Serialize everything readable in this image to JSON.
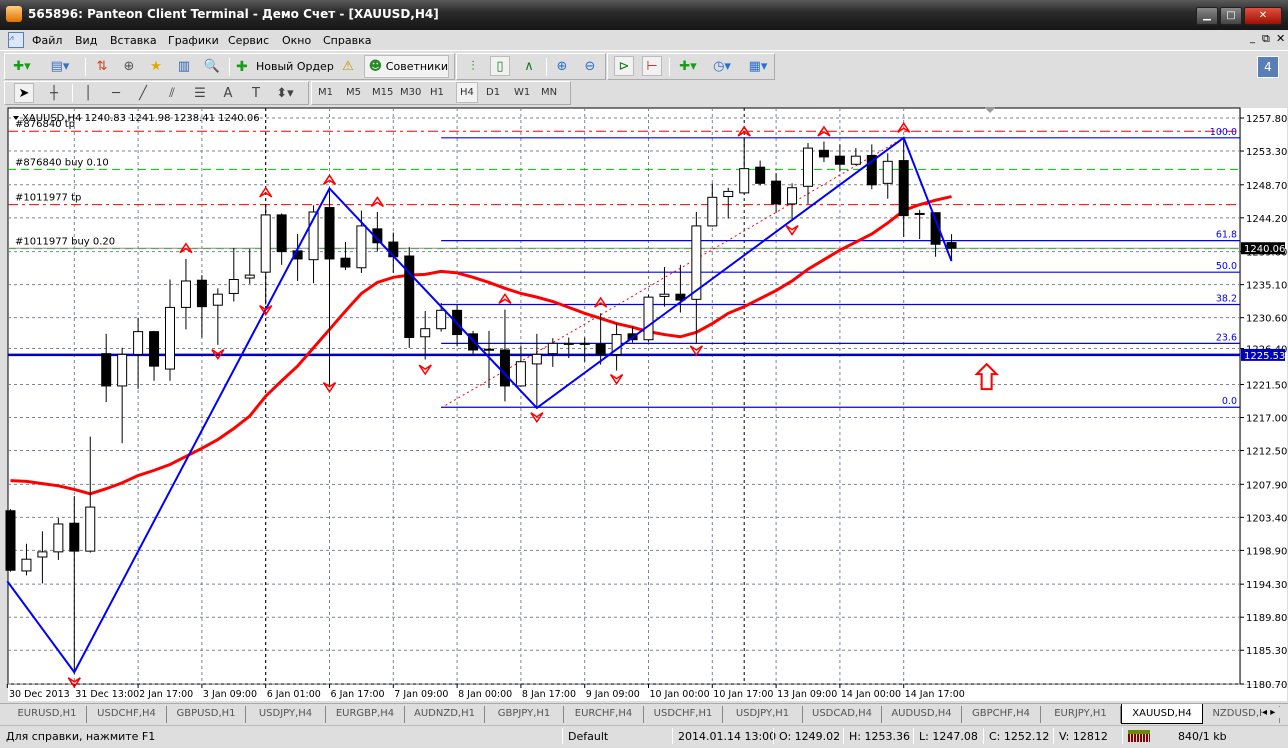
{
  "window": {
    "title": "565896: Panteon Client Terminal - Демо Счет - [XAUUSD,H4]"
  },
  "menu": [
    "Файл",
    "Вид",
    "Вставка",
    "Графики",
    "Сервис",
    "Окно",
    "Справка"
  ],
  "toolbar": {
    "new_order": "Новый Ордер",
    "experts": "Советники",
    "notification_count": "4"
  },
  "timeframes": [
    "M1",
    "M5",
    "M15",
    "M30",
    "H1",
    "H4",
    "D1",
    "W1",
    "MN"
  ],
  "active_timeframe": "H4",
  "chart_header": {
    "symbol": "XAUUSD,H4",
    "ohlc": "1240.83 1241.98 1238.41 1240.06"
  },
  "order_lines": [
    {
      "label": "#876840 tp",
      "price": 1256.0,
      "color": "#ff0000",
      "style": "dashdot"
    },
    {
      "label": "#876840 buy 0.10",
      "price": 1250.8,
      "color": "#00c000",
      "style": "dash"
    },
    {
      "label": "#1011977 tp",
      "price": 1246.0,
      "color": "#ff0000",
      "style": "dashdot"
    },
    {
      "label": "#1011977 buy 0.20",
      "price": 1240.0,
      "color": "#00c000",
      "style": "dash"
    }
  ],
  "price_badges": {
    "bid": "1240.06",
    "hline": "1225.53"
  },
  "tabs": [
    "EURUSD,H1",
    "USDCHF,H4",
    "GBPUSD,H1",
    "USDJPY,H4",
    "EURGBP,H4",
    "AUDNZD,H1",
    "GBPJPY,H1",
    "EURCHF,H4",
    "USDCHF,H1",
    "USDJPY,H1",
    "USDCAD,H4",
    "AUDUSD,H4",
    "GBPCHF,H4",
    "EURJPY,H1",
    "XAUUSD,H4",
    "NZDUSD,H"
  ],
  "active_tab": "XAUUSD,H4",
  "status": {
    "help": "Для справки, нажмите F1",
    "profile": "Default",
    "time": "2014.01.14 13:00",
    "open": "O: 1249.02",
    "high": "H: 1253.36",
    "low": "L: 1247.08",
    "close": "C: 1252.12",
    "volume": "V: 12812",
    "traffic": "840/1 kb"
  },
  "chart_data": {
    "type": "candlestick",
    "symbol": "XAUUSD",
    "timeframe": "H4",
    "ylim": [
      1180.7,
      1257.8
    ],
    "y_ticks": [
      "1257.80",
      "1253.30",
      "1248.70",
      "1244.20",
      "1239.60",
      "1235.10",
      "1230.60",
      "1226.40",
      "1221.50",
      "1217.00",
      "1212.50",
      "1207.90",
      "1203.40",
      "1198.90",
      "1194.30",
      "1189.80",
      "1185.30",
      "1180.70"
    ],
    "x_ticks": [
      {
        "index": -0.2,
        "label": "30 Dec 2013"
      },
      {
        "index": 4,
        "label": "31 Dec 13:00"
      },
      {
        "index": 8,
        "label": "2 Jan 17:00"
      },
      {
        "index": 12,
        "label": "3 Jan 09:00"
      },
      {
        "index": 16,
        "label": "6 Jan 01:00"
      },
      {
        "index": 20,
        "label": "6 Jan 17:00"
      },
      {
        "index": 24,
        "label": "7 Jan 09:00"
      },
      {
        "index": 28,
        "label": "8 Jan 00:00"
      },
      {
        "index": 32,
        "label": "8 Jan 17:00"
      },
      {
        "index": 36,
        "label": "9 Jan 09:00"
      },
      {
        "index": 40,
        "label": "10 Jan 00:00"
      },
      {
        "index": 44,
        "label": "10 Jan 17:00"
      },
      {
        "index": 48,
        "label": "13 Jan 09:00"
      },
      {
        "index": 52,
        "label": "14 Jan 00:00"
      },
      {
        "index": 56,
        "label": "14 Jan 17:00"
      }
    ],
    "candles_ohlc": [
      [
        1204.3,
        1204.5,
        1196.0,
        1196.2
      ],
      [
        1196.1,
        1199.8,
        1195.5,
        1197.7
      ],
      [
        1198.0,
        1201.5,
        1194.4,
        1198.7
      ],
      [
        1198.7,
        1203.3,
        1197.6,
        1202.5
      ],
      [
        1202.6,
        1206.3,
        1182.1,
        1198.8
      ],
      [
        1198.8,
        1214.4,
        1198.6,
        1204.8
      ],
      [
        1225.7,
        1228.4,
        1219.1,
        1221.3
      ],
      [
        1221.3,
        1226.5,
        1213.5,
        1225.6
      ],
      [
        1225.6,
        1230.6,
        1220.9,
        1228.7
      ],
      [
        1228.7,
        1228.8,
        1222.0,
        1224.0
      ],
      [
        1223.6,
        1235.8,
        1222.0,
        1232.0
      ],
      [
        1232.0,
        1238.6,
        1229.0,
        1235.6
      ],
      [
        1235.7,
        1236.4,
        1227.9,
        1232.1
      ],
      [
        1232.3,
        1234.6,
        1226.9,
        1233.8
      ],
      [
        1233.9,
        1240.1,
        1232.8,
        1235.8
      ],
      [
        1236.0,
        1240.0,
        1235.2,
        1236.4
      ],
      [
        1236.8,
        1246.1,
        1232.4,
        1244.6
      ],
      [
        1244.6,
        1244.8,
        1237.8,
        1239.6
      ],
      [
        1239.7,
        1242.0,
        1235.6,
        1238.6
      ],
      [
        1238.5,
        1245.9,
        1235.3,
        1245.0
      ],
      [
        1245.6,
        1247.9,
        1221.4,
        1238.6
      ],
      [
        1238.7,
        1240.9,
        1237.1,
        1237.5
      ],
      [
        1237.4,
        1245.2,
        1236.7,
        1243.1
      ],
      [
        1242.7,
        1245.0,
        1239.6,
        1240.8
      ],
      [
        1240.9,
        1242.2,
        1236.7,
        1238.9
      ],
      [
        1239.0,
        1240.2,
        1226.5,
        1227.9
      ],
      [
        1228.0,
        1231.5,
        1224.9,
        1229.1
      ],
      [
        1229.1,
        1232.6,
        1228.7,
        1231.6
      ],
      [
        1231.6,
        1232.4,
        1226.7,
        1228.3
      ],
      [
        1228.4,
        1228.8,
        1225.6,
        1226.2
      ],
      [
        1226.2,
        1228.8,
        1221.0,
        1226.3
      ],
      [
        1226.2,
        1231.7,
        1219.2,
        1221.3
      ],
      [
        1221.3,
        1226.8,
        1221.2,
        1224.6
      ],
      [
        1224.3,
        1228.4,
        1218.3,
        1225.6
      ],
      [
        1225.7,
        1227.8,
        1223.9,
        1227.1
      ],
      [
        1227.0,
        1227.9,
        1225.1,
        1227.1
      ],
      [
        1227.1,
        1227.9,
        1224.6,
        1227.0
      ],
      [
        1227.0,
        1231.2,
        1224.2,
        1225.6
      ],
      [
        1225.6,
        1229.8,
        1223.4,
        1228.3
      ],
      [
        1228.4,
        1229.4,
        1227.2,
        1227.6
      ],
      [
        1227.6,
        1233.7,
        1227.3,
        1233.4
      ],
      [
        1233.5,
        1237.5,
        1232.1,
        1233.8
      ],
      [
        1233.8,
        1237.8,
        1231.3,
        1233.0
      ],
      [
        1233.1,
        1245.0,
        1227.1,
        1243.1
      ],
      [
        1243.1,
        1248.9,
        1243.0,
        1247.0
      ],
      [
        1247.1,
        1248.3,
        1244.1,
        1247.8
      ],
      [
        1247.6,
        1255.1,
        1247.5,
        1250.9
      ],
      [
        1251.1,
        1252.0,
        1248.6,
        1248.9
      ],
      [
        1249.2,
        1250.3,
        1244.9,
        1246.1
      ],
      [
        1246.1,
        1248.9,
        1243.8,
        1248.3
      ],
      [
        1248.5,
        1254.4,
        1246.1,
        1253.7
      ],
      [
        1253.4,
        1254.6,
        1251.8,
        1252.5
      ],
      [
        1252.6,
        1254.2,
        1250.5,
        1251.5
      ],
      [
        1251.5,
        1253.7,
        1251.4,
        1252.6
      ],
      [
        1252.7,
        1254.2,
        1248.1,
        1248.7
      ],
      [
        1248.9,
        1253.0,
        1246.8,
        1251.9
      ],
      [
        1252.0,
        1255.0,
        1241.6,
        1244.5
      ],
      [
        1244.7,
        1245.3,
        1241.3,
        1244.8
      ],
      [
        1244.9,
        1244.9,
        1238.9,
        1240.6
      ],
      [
        1240.83,
        1241.98,
        1238.41,
        1240.06
      ]
    ],
    "moving_average": [
      1208.4,
      1208.3,
      1208.0,
      1207.7,
      1207.2,
      1206.6,
      1207.3,
      1208.1,
      1209.1,
      1209.8,
      1210.6,
      1211.7,
      1212.8,
      1214.0,
      1215.5,
      1217.2,
      1219.9,
      1222.0,
      1224.0,
      1226.5,
      1229.0,
      1231.5,
      1233.9,
      1235.4,
      1236.1,
      1236.4,
      1236.5,
      1236.9,
      1236.7,
      1236.1,
      1235.4,
      1234.6,
      1233.9,
      1233.4,
      1232.8,
      1232.0,
      1231.2,
      1230.5,
      1229.8,
      1229.3,
      1228.7,
      1228.3,
      1228.0,
      1228.6,
      1229.8,
      1231.2,
      1232.1,
      1233.2,
      1234.3,
      1235.6,
      1237.2,
      1238.5,
      1239.8,
      1240.9,
      1242.0,
      1243.5,
      1245.2,
      1246.0,
      1246.6,
      1247.1
    ],
    "zigzag": [
      [
        -0.2,
        1194.7
      ],
      [
        4,
        1182.3
      ],
      [
        20,
        1248.2
      ],
      [
        33,
        1218.3
      ],
      [
        56,
        1255.1
      ],
      [
        59,
        1238.3
      ]
    ],
    "fibo": {
      "from": [
        27,
        1218.3
      ],
      "to": [
        56,
        1255.1
      ],
      "levels": [
        {
          "label": "100.0",
          "price": 1255.1
        },
        {
          "label": "61.8",
          "price": 1241.1
        },
        {
          "label": "50.0",
          "price": 1236.8
        },
        {
          "label": "38.2",
          "price": 1232.4
        },
        {
          "label": "23.6",
          "price": 1227.1
        },
        {
          "label": "0.0",
          "price": 1218.4
        }
      ]
    },
    "horizontal_line": 1225.53,
    "bid": 1240.06,
    "vertical_lines": [
      16,
      46
    ],
    "fractals_up": [
      [
        11,
        1240.0
      ],
      [
        16,
        1247.6
      ],
      [
        20,
        1249.3
      ],
      [
        23,
        1246.3
      ],
      [
        31,
        1233.1
      ],
      [
        37,
        1232.6
      ],
      [
        46,
        1255.9
      ],
      [
        51,
        1255.9
      ],
      [
        56,
        1256.4
      ]
    ],
    "fractals_down": [
      [
        4,
        1181.0
      ],
      [
        13,
        1225.7
      ],
      [
        16,
        1231.7
      ],
      [
        20,
        1221.2
      ],
      [
        26,
        1223.6
      ],
      [
        33,
        1217.1
      ],
      [
        38,
        1222.3
      ],
      [
        43,
        1226.2
      ],
      [
        49,
        1242.6
      ]
    ],
    "signal_arrow": {
      "index": 61.2,
      "price": 1222.5,
      "direction": "up"
    },
    "colors": {
      "ma": "#ff0000",
      "zigzag": "#0000ff",
      "fibo": "#0000ff",
      "grid": "#7b8593"
    }
  }
}
